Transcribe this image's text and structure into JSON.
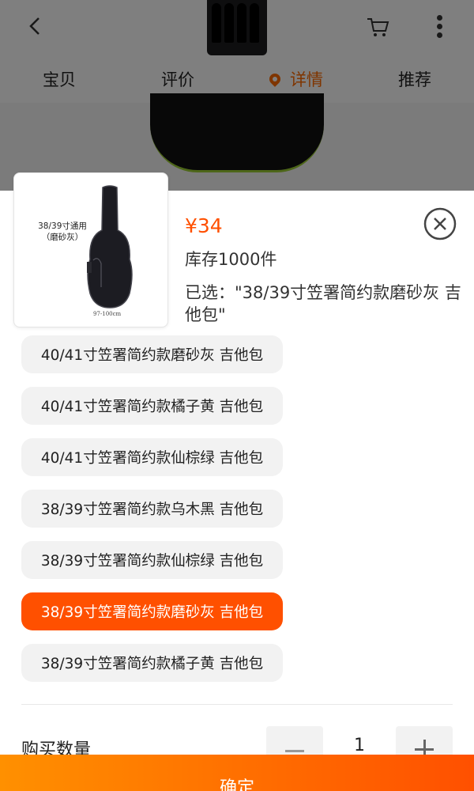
{
  "background_page": {
    "tabs": [
      {
        "label": "宝贝",
        "active": false
      },
      {
        "label": "评价",
        "active": false
      },
      {
        "label": "详情",
        "active": true
      },
      {
        "label": "推荐",
        "active": false
      }
    ]
  },
  "product": {
    "image_label": "38/39寸通用\n（磨砂灰）",
    "image_size_text": "97-100cm",
    "price": "¥34",
    "stock": "库存1000件",
    "selected_text": "已选：\"38/39寸笠署简约款磨砂灰 吉他包\""
  },
  "options": [
    {
      "label": "40/41寸笠署简约款磨砂灰 吉他包",
      "selected": false
    },
    {
      "label": "40/41寸笠署简约款橘子黄 吉他包",
      "selected": false
    },
    {
      "label": "40/41寸笠署简约款仙棕绿 吉他包",
      "selected": false
    },
    {
      "label": "38/39寸笠署简约款乌木黑 吉他包",
      "selected": false
    },
    {
      "label": "38/39寸笠署简约款仙棕绿 吉他包",
      "selected": false
    },
    {
      "label": "38/39寸笠署简约款磨砂灰 吉他包",
      "selected": true
    },
    {
      "label": "38/39寸笠署简约款橘子黄 吉他包",
      "selected": false
    }
  ],
  "quantity": {
    "label": "购买数量",
    "value": "1"
  },
  "confirm_label": "确定",
  "colors": {
    "accent": "#ff5000",
    "accent_gradient_start": "#ff9000",
    "option_bg": "#f2f2f2"
  },
  "icons": [
    "back-icon",
    "cart-icon",
    "more-icon",
    "location-pin-icon",
    "close-icon",
    "minus-icon",
    "plus-icon"
  ]
}
